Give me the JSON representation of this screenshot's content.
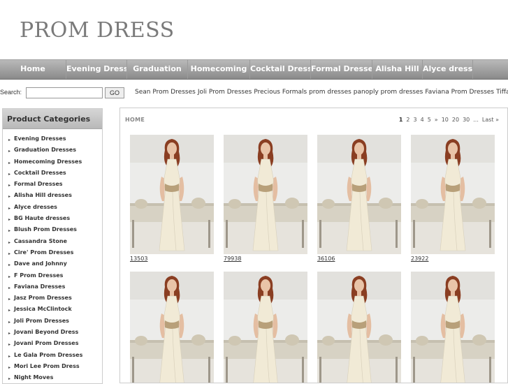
{
  "site": {
    "logo_text": "PROM DRESS"
  },
  "nav": {
    "items": [
      {
        "label": "Home"
      },
      {
        "label": "Evening Dresses"
      },
      {
        "label": "Graduation"
      },
      {
        "label": "Homecoming"
      },
      {
        "label": "Cocktail Dresses"
      },
      {
        "label": "Formal Dresses"
      },
      {
        "label": "Alisha Hill"
      },
      {
        "label": "Alyce dresses"
      }
    ]
  },
  "search": {
    "label": "Search:",
    "value": "",
    "button_label": "GO",
    "quick_links": [
      "Sean Prom Dresses",
      "Joli Prom Dresses",
      "Precious Formals prom dresses",
      "panoply prom dresses",
      "Faviana Prom Dresses",
      "Tiffany Prom"
    ]
  },
  "sidebar": {
    "title": "Product Categories",
    "categories": [
      "Evening Dresses",
      "Graduation Dresses",
      "Homecoming Dresses",
      "Cocktail Dresses",
      "Formal Dresses",
      "Alisha Hill dresses",
      "Alyce dresses",
      "BG Haute dresses",
      "Blush Prom Dresses",
      "Cassandra Stone",
      "Cire' Prom Dresses",
      "Dave and Johnny",
      "F Prom Dresses",
      "Faviana Dresses",
      "Jasz Prom Dresses",
      "Jessica McClintock",
      "Joli Prom Dresses",
      "Jovani Beyond Dress",
      "Jovani Prom Dresses",
      "Le Gala Prom Dresses",
      "Mori Lee Prom Dress",
      "Night Moves"
    ]
  },
  "main": {
    "breadcrumb": "HOME",
    "pager": [
      "1",
      "2",
      "3",
      "4",
      "5",
      "»",
      "10",
      "20",
      "30",
      "...",
      "Last »"
    ],
    "pager_current": "1",
    "products": [
      {
        "code": "13503"
      },
      {
        "code": "79938"
      },
      {
        "code": "36106"
      },
      {
        "code": "23922"
      },
      {
        "code": ""
      },
      {
        "code": ""
      },
      {
        "code": ""
      },
      {
        "code": ""
      }
    ]
  },
  "colors": {
    "nav_bg": "#9a9a9a",
    "logo": "#7a7a7a",
    "dress": "#f1ead6",
    "hair": "#8a3e22",
    "room_wall": "#ececea",
    "bench": "#d7d2c4"
  }
}
